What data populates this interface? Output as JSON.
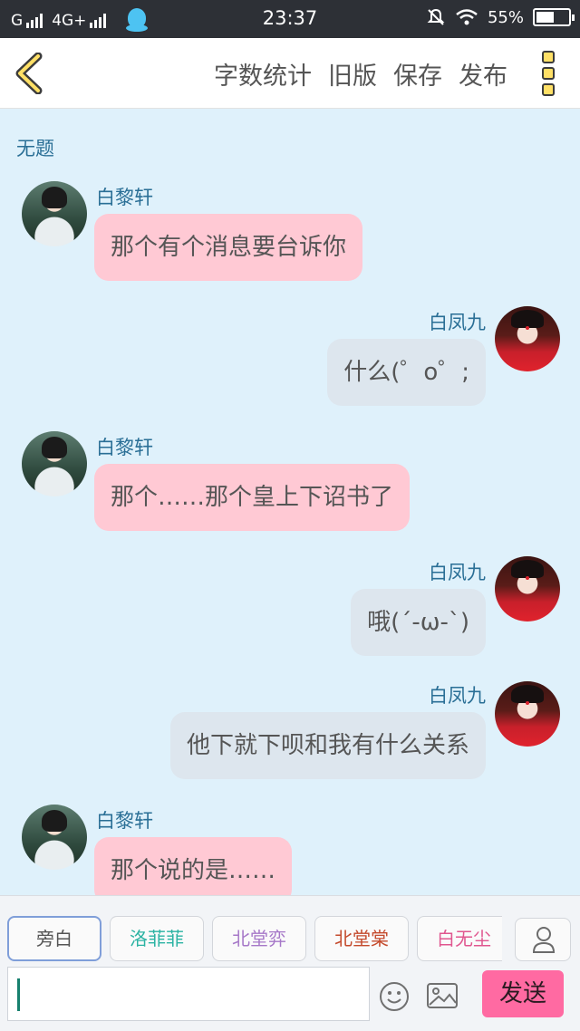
{
  "status_bar": {
    "carrier1": "G",
    "carrier2": "4G+",
    "time": "23:37",
    "battery": "55%",
    "battery_level": 0.55
  },
  "header": {
    "actions": [
      "字数统计",
      "旧版",
      "保存",
      "发布"
    ]
  },
  "chat": {
    "title": "无题",
    "messages": [
      {
        "side": "left",
        "name": "白黎轩",
        "text": "那个有个消息要台诉你"
      },
      {
        "side": "right",
        "name": "白凤九",
        "text": "什么(゜o゜;"
      },
      {
        "side": "left",
        "name": "白黎轩",
        "text": "那个……那个皇上下诏书了"
      },
      {
        "side": "right",
        "name": "白凤九",
        "text": "哦(´-ω-`)"
      },
      {
        "side": "right",
        "name": "白凤九",
        "text": "他下就下呗和我有什么关系"
      },
      {
        "side": "left",
        "name": "白黎轩",
        "text": "那个说的是……"
      }
    ]
  },
  "roles": [
    {
      "label": "旁白",
      "color": "#555555"
    },
    {
      "label": "洛菲菲",
      "color": "#2bb3a3"
    },
    {
      "label": "北堂弈",
      "color": "#a678c8"
    },
    {
      "label": "北堂棠",
      "color": "#c44a2c"
    },
    {
      "label": "白无尘",
      "color": "#e0568f"
    }
  ],
  "composer": {
    "send_label": "发送"
  },
  "icons": {
    "back": "chevron-left-icon",
    "menu": "more-vertical-icon",
    "person": "person-icon",
    "emoji": "smiley-icon",
    "image": "image-icon"
  }
}
